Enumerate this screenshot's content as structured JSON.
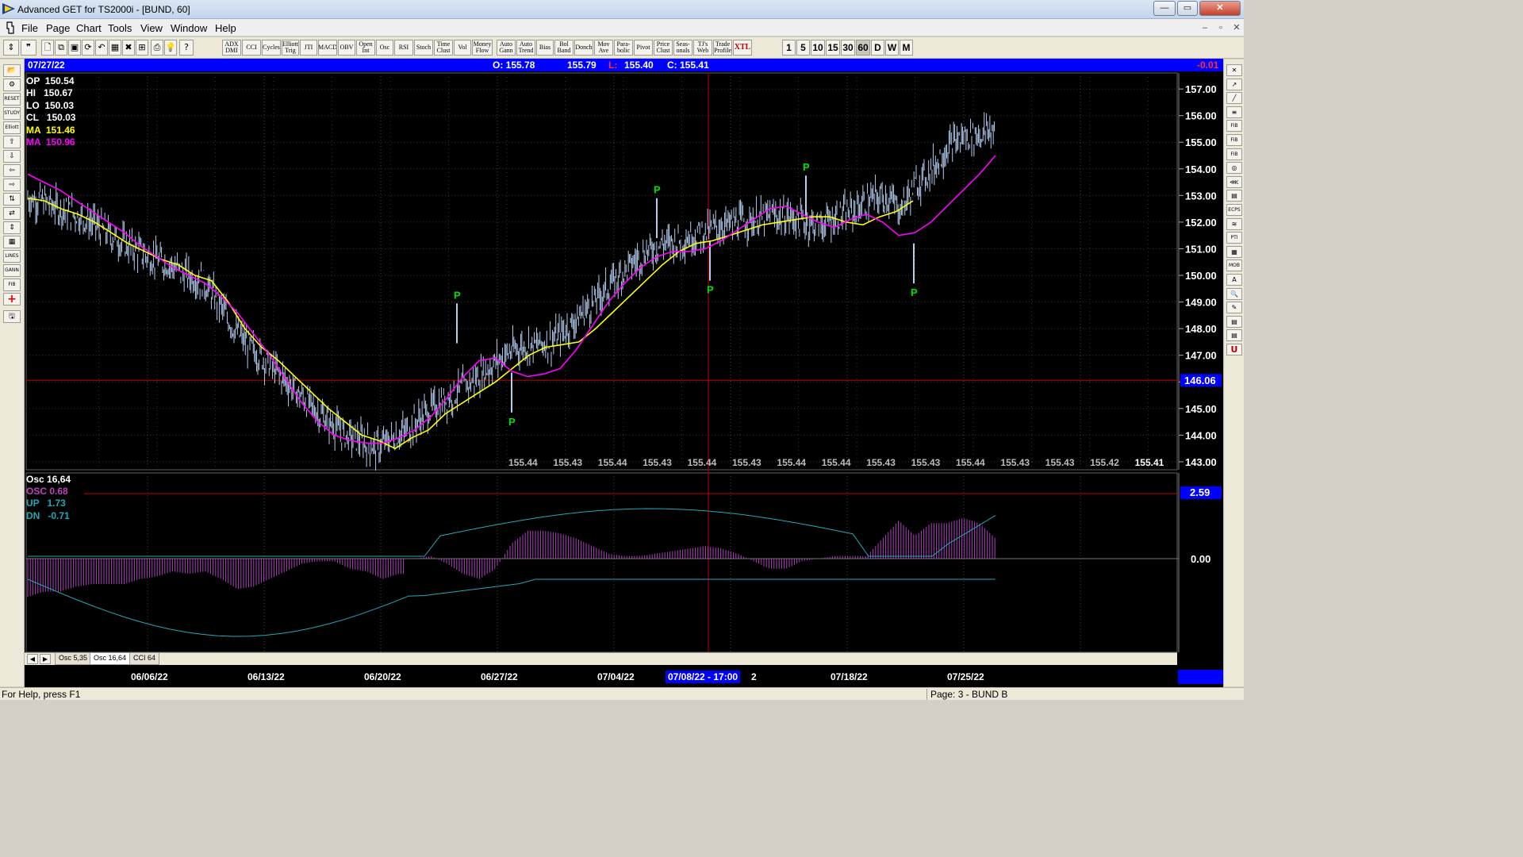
{
  "window": {
    "title": "Advanced GET for TS2000i - [BUND, 60]",
    "controls": {
      "minimize": "—",
      "maximize": "▭",
      "close": "✕"
    }
  },
  "menu": {
    "items": [
      "File",
      "Page",
      "Chart",
      "Tools",
      "View",
      "Window",
      "Help"
    ],
    "mdi_controls": {
      "minimize": "–",
      "restore": "▫",
      "close": "✕"
    }
  },
  "toolbar": {
    "buttons": [
      "ADX DMI",
      "CCI",
      "Cycles",
      "Elliott Trig",
      "JTI",
      "MACD",
      "OBV",
      "Open Int",
      "Osc",
      "RSI",
      "Stoch",
      "Time Clust",
      "Vol",
      "Money Flow",
      "Auto Gann",
      "Auto Trend",
      "Bias",
      "Bol Band",
      "Donch",
      "Mov Ave",
      "Para-bolic",
      "Pivot",
      "Price Clust",
      "Seas-onals",
      "TJ's Web",
      "Trade Profile",
      "XTL"
    ],
    "periods": [
      "1",
      "5",
      "10",
      "15",
      "30",
      "60",
      "D",
      "W",
      "M"
    ],
    "active_period": "60"
  },
  "left_tools": [
    "📂",
    "⚙",
    "RESET",
    "STUDY",
    "Elliott",
    "⇧",
    "⇩",
    "⇦",
    "⇨",
    "⇅",
    "⇄",
    "⇕",
    "▦",
    "LINES",
    "GANN",
    "FIB",
    "+",
    "🖫"
  ],
  "right_tools": [
    "✕",
    "↗",
    "╱",
    "≡",
    "FIB RET",
    "FIB EXT",
    "FIB TIME",
    "◎",
    "⋘",
    "▤",
    "ECPS",
    "≋",
    "PTI",
    "▦",
    "MOB",
    "A",
    "🔍",
    "✎",
    "▤",
    "▤",
    "U"
  ],
  "infobar": {
    "date": "07/27/22",
    "open": "O: 155.78",
    "high": "155.79",
    "low_label": "L:",
    "low_value": "155.40",
    "close": "C: 155.41",
    "change": "-0.01"
  },
  "legend": {
    "op": "OP  150.54",
    "hi": "HI   150.67",
    "lo": "LO  150.03",
    "cl": "CL   150.03",
    "ma1": "MA  151.46",
    "ma2": "MA  150.96"
  },
  "osc_legend": {
    "title": "Osc 16,64",
    "osc": "OSC 0.68",
    "up": "UP   1.73",
    "dn": "DN   -0.71"
  },
  "price_axis": {
    "labels": [
      "157.00",
      "156.00",
      "155.00",
      "154.00",
      "153.00",
      "152.00",
      "151.00",
      "150.00",
      "149.00",
      "148.00",
      "147.00",
      "146.00",
      "145.00",
      "144.00",
      "143.00"
    ],
    "cursor_price": "146.06"
  },
  "osc_axis": {
    "labels": [
      "0.00"
    ],
    "cursor_value": "2.59"
  },
  "bottom_prices": [
    "155.44",
    "155.43",
    "155.44",
    "155.43",
    "155.44",
    "155.43",
    "155.44",
    "155.44",
    "155.43",
    "155.43",
    "155.44",
    "155.43",
    "155.43",
    "155.42",
    "155.41"
  ],
  "tabs": {
    "nav_prev": "◀",
    "nav_next": "▶",
    "items": [
      "Osc 5,35",
      "Osc 16,64",
      "CCI 64"
    ],
    "active": 1
  },
  "dates": {
    "labels": [
      "06/06/22",
      "06/13/22",
      "06/20/22",
      "06/27/22",
      "07/04/22",
      "07/18/22",
      "07/25/22"
    ],
    "cursor": "07/08/22 - 17:00",
    "cursor_suffix": "2"
  },
  "status": {
    "help": "For Help, press F1",
    "page": "Page: 3 - BUND B"
  },
  "pivot_marker": "P",
  "colors": {
    "background": "#000000",
    "price_bars": "#b4cdf0",
    "ma_fast": "#ffff00",
    "ma_slow": "#ff00ff",
    "osc": "#b040c0",
    "bands": "#20a8b8",
    "pivot": "#00e000",
    "cursor": "#c00000",
    "infobar": "#0000ff"
  },
  "chart_data": {
    "type": "line",
    "series": [
      {
        "values": [
          152.9,
          152.8,
          152.5,
          152.3,
          152.0,
          151.6,
          151.2,
          150.9,
          150.6,
          150.4,
          150.0,
          149.8,
          149.0,
          148.0,
          147.3,
          146.8,
          146.2,
          145.6,
          145.0,
          144.5,
          144.0,
          143.8,
          143.5,
          143.9,
          144.2,
          144.8,
          145.2,
          145.6,
          146.0,
          146.5,
          147.0,
          147.3,
          147.4,
          147.5,
          148.0,
          148.6,
          149.2,
          149.8,
          150.4,
          150.9,
          151.2,
          151.3,
          151.5,
          151.7,
          151.9,
          152.0,
          152.1,
          152.2,
          152.2,
          152.0,
          151.9,
          152.2,
          152.4,
          152.8,
          153.0,
          152.5,
          153.4,
          154.0,
          154.8,
          155.2,
          155.3,
          155.5
        ]
      },
      {
        "values": [
          153.8,
          153.5,
          153.2,
          152.8,
          152.4,
          152.0,
          151.6,
          151.1,
          150.7,
          150.3,
          150.0,
          149.7,
          149.2,
          148.6,
          147.8,
          147.0,
          146.1,
          145.2,
          144.5,
          144.0,
          143.8,
          143.7,
          143.7,
          143.9,
          144.2,
          144.7,
          145.4,
          146.2,
          146.8,
          146.9,
          146.4,
          146.2,
          146.3,
          146.5,
          147.2,
          148.1,
          149.0,
          149.7,
          150.3,
          150.7,
          150.9,
          150.9,
          151.0,
          151.3,
          151.7,
          152.1,
          152.5,
          152.6,
          152.3,
          152.0,
          151.8,
          152.1,
          152.3,
          152.0,
          151.5,
          151.6,
          152.0,
          152.6,
          153.2,
          153.8,
          154.5
        ]
      }
    ],
    "pivots": [
      {
        "date": "06/23/22",
        "price": 148.95
      },
      {
        "date": "06/27/22",
        "price": 144.85
      },
      {
        "date": "07/06/22",
        "price": 152.9
      },
      {
        "date": "07/08/22",
        "price": 149.8
      },
      {
        "date": "07/13/22",
        "price": 153.75
      },
      {
        "date": "07/20/22",
        "price": 149.7
      }
    ],
    "price_range": [
      142.7,
      157.6
    ],
    "osc_zero_line": 0.0,
    "osc_levels": {
      "cursor": 2.59
    }
  }
}
